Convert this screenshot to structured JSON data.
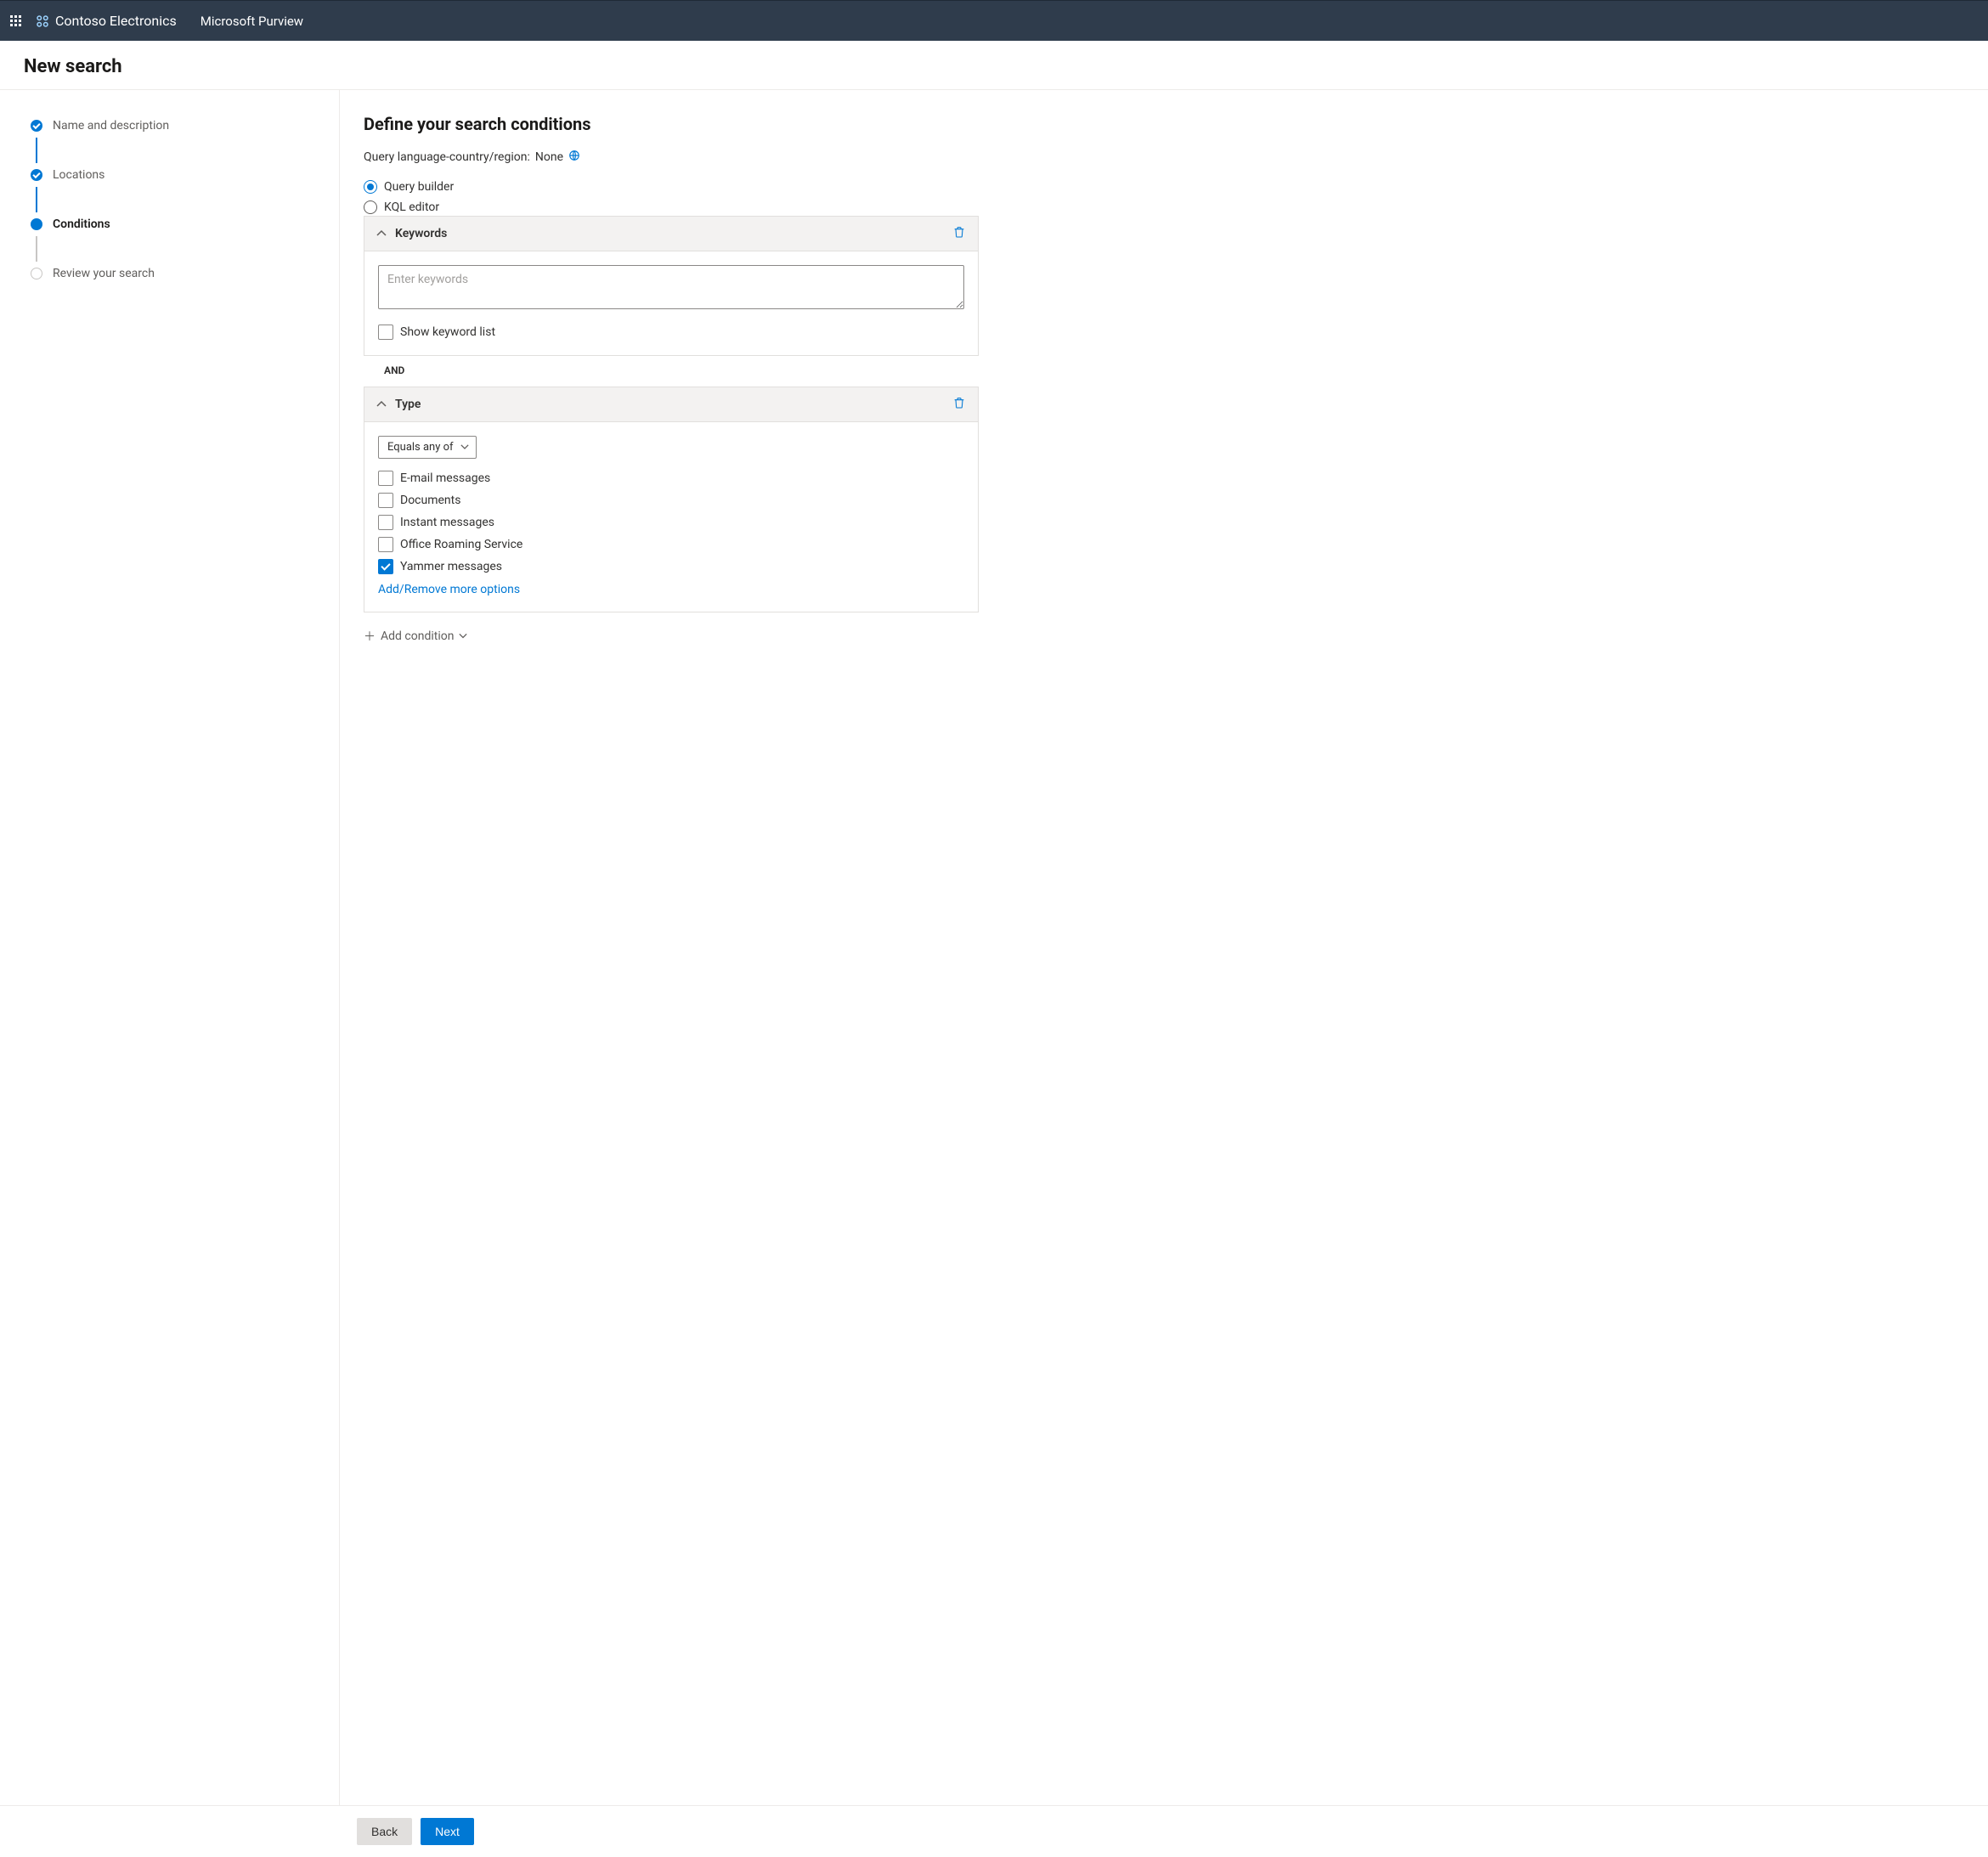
{
  "topbar": {
    "org": "Contoso Electronics",
    "product": "Microsoft Purview"
  },
  "header": {
    "title": "New search"
  },
  "wizard": {
    "steps": [
      {
        "label": "Name and description",
        "state": "done"
      },
      {
        "label": "Locations",
        "state": "done"
      },
      {
        "label": "Conditions",
        "state": "current"
      },
      {
        "label": "Review your search",
        "state": "future"
      }
    ]
  },
  "main": {
    "heading": "Define your search conditions",
    "locale_label": "Query language-country/region:",
    "locale_value": "None",
    "query_modes": {
      "builder": "Query builder",
      "kql": "KQL editor",
      "selected": "builder"
    },
    "keywords_card": {
      "title": "Keywords",
      "placeholder": "Enter keywords",
      "value": "",
      "show_list_label": "Show keyword list",
      "show_list_checked": false
    },
    "operator": "AND",
    "type_card": {
      "title": "Type",
      "operator_value": "Equals any of",
      "options": [
        {
          "label": "E-mail messages",
          "checked": false
        },
        {
          "label": "Documents",
          "checked": false
        },
        {
          "label": "Instant messages",
          "checked": false
        },
        {
          "label": "Office Roaming Service",
          "checked": false
        },
        {
          "label": "Yammer messages",
          "checked": true
        }
      ],
      "more_link": "Add/Remove more options"
    },
    "add_condition_label": "Add condition"
  },
  "footer": {
    "back": "Back",
    "next": "Next"
  }
}
